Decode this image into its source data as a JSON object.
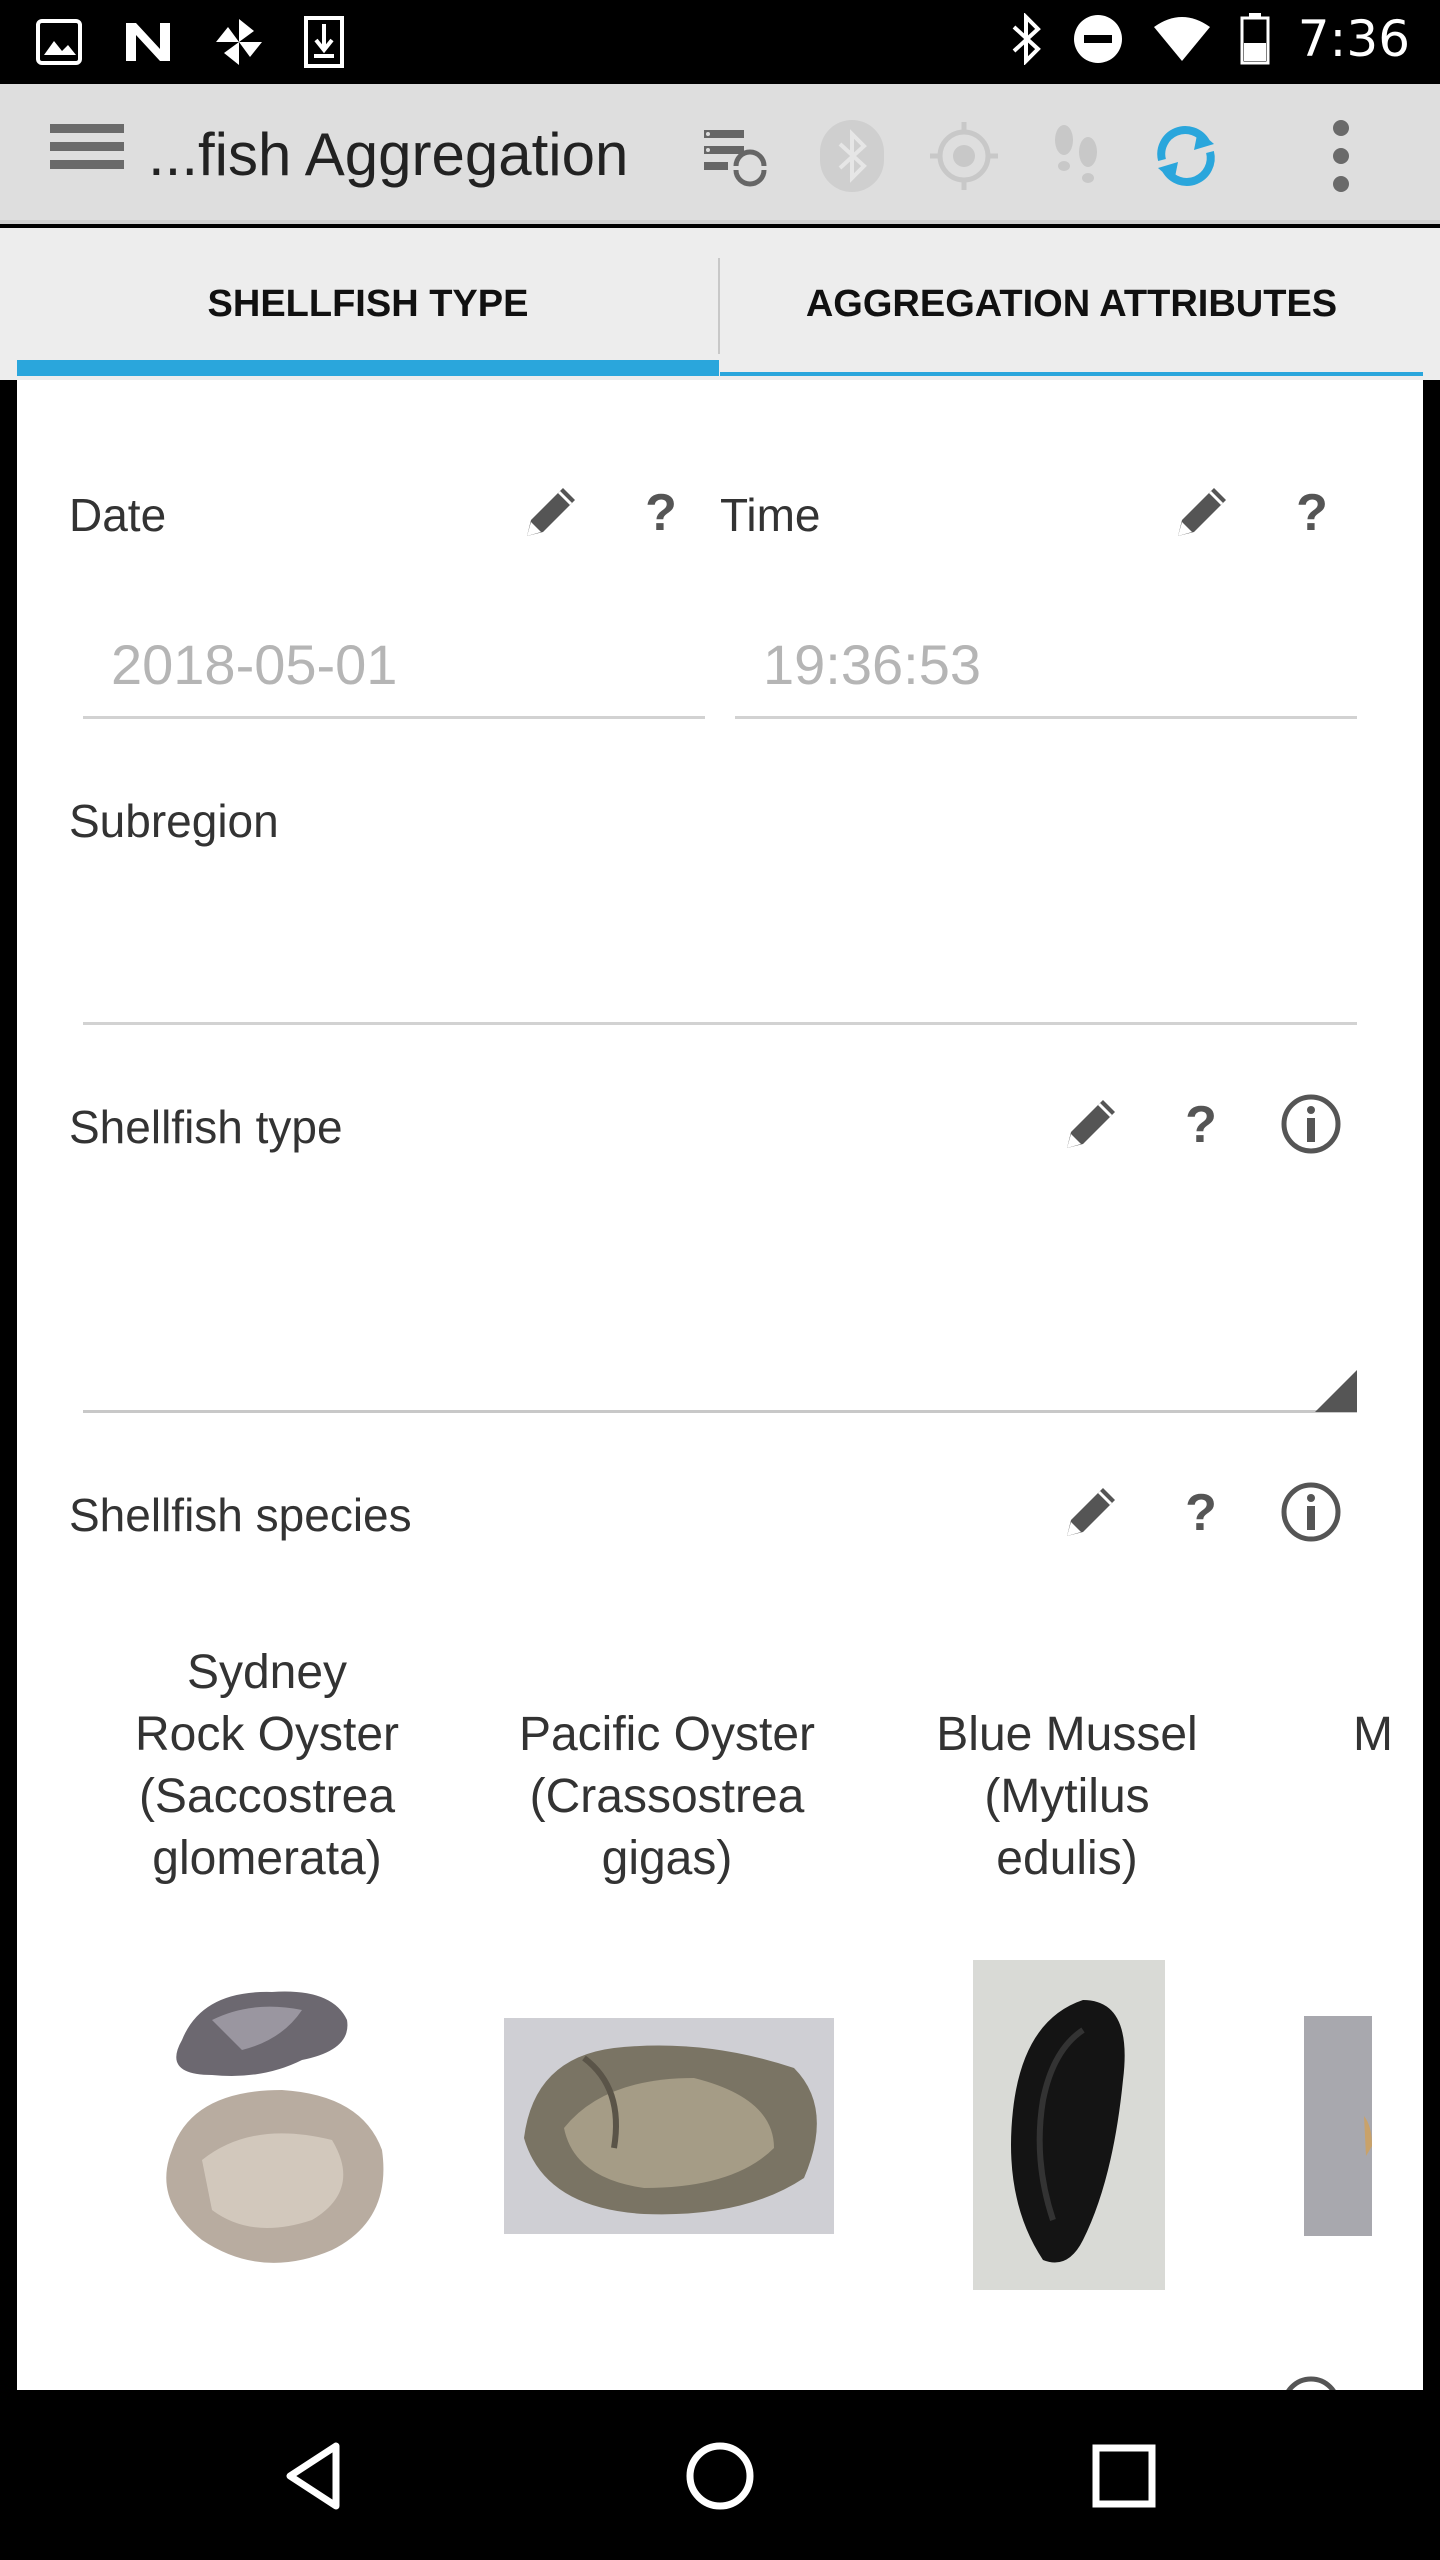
{
  "status_bar": {
    "time": "7:36",
    "icons": [
      "image-icon",
      "n-icon",
      "pinwheel-icon",
      "download-icon",
      "bluetooth-icon",
      "do-not-disturb-icon",
      "wifi-icon",
      "battery-icon"
    ]
  },
  "action_bar": {
    "title": "...fish Aggregation",
    "icons": [
      "menu-icon",
      "server-sync-icon",
      "bluetooth-icon",
      "gps-target-icon",
      "footsteps-icon",
      "sync-icon",
      "overflow-menu-icon"
    ],
    "accent": "#2aa6dc"
  },
  "tabs": [
    {
      "label": "SHELLFISH TYPE",
      "selected": true
    },
    {
      "label": "AGGREGATION ATTRIBUTES",
      "selected": false
    }
  ],
  "form": {
    "date": {
      "label": "Date",
      "value": "2018-05-01"
    },
    "time": {
      "label": "Time",
      "value": "19:36:53"
    },
    "subregion": {
      "label": "Subregion",
      "value": ""
    },
    "shellfish_type": {
      "label": "Shellfish type",
      "value": ""
    },
    "shellfish_species": {
      "label": "Shellfish species",
      "items": [
        {
          "name": "Sydney Rock Oyster (Saccostrea glomerata)",
          "lines": [
            "Sydney",
            "Rock Oyster",
            "(Saccostrea",
            "glomerata)"
          ]
        },
        {
          "name": "Pacific Oyster (Crassostrea gigas)",
          "lines": [
            "Pacific Oyster",
            "(Crassostrea",
            "gigas)"
          ]
        },
        {
          "name": "Blue Mussel (Mytilus edulis)",
          "lines": [
            "Blue Mussel",
            "(Mytilus",
            "edulis)"
          ]
        },
        {
          "name": "M",
          "lines": [
            "M"
          ]
        }
      ]
    }
  },
  "nav_bar": {
    "icons": [
      "back-icon",
      "home-icon",
      "recents-icon"
    ]
  }
}
